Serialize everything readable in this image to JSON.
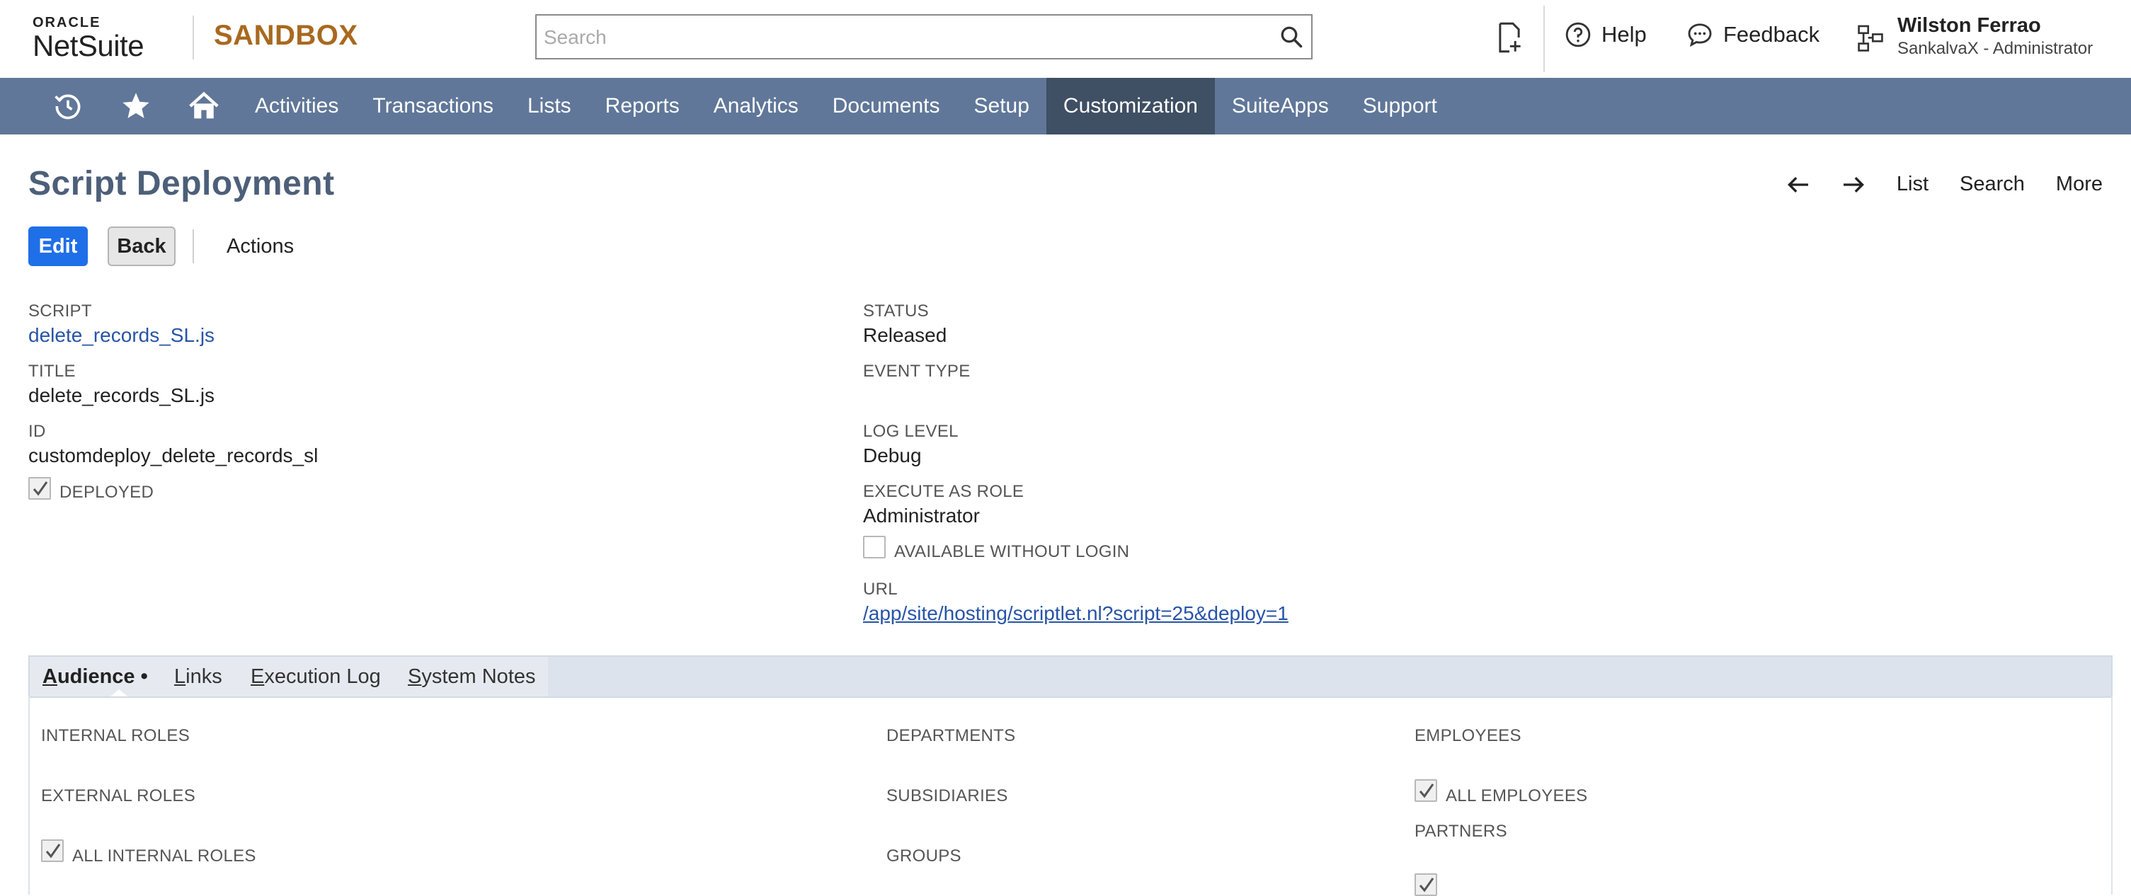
{
  "header": {
    "logo_top": "ORACLE",
    "logo_bottom": "NetSuite",
    "environment": "SANDBOX",
    "search_placeholder": "Search",
    "help": "Help",
    "feedback": "Feedback",
    "user_name": "Wilston Ferrao",
    "user_role": "SankalvaX - Administrator"
  },
  "nav": {
    "items": [
      {
        "label": "Activities"
      },
      {
        "label": "Transactions"
      },
      {
        "label": "Lists"
      },
      {
        "label": "Reports"
      },
      {
        "label": "Analytics"
      },
      {
        "label": "Documents"
      },
      {
        "label": "Setup"
      },
      {
        "label": "Customization"
      },
      {
        "label": "SuiteApps"
      },
      {
        "label": "Support"
      }
    ],
    "active": "Customization"
  },
  "page": {
    "title": "Script Deployment",
    "tools": {
      "list": "List",
      "search": "Search",
      "more": "More"
    },
    "buttons": {
      "edit": "Edit",
      "back": "Back",
      "actions": "Actions"
    }
  },
  "fields": {
    "script_label": "SCRIPT",
    "script_value": "delete_records_SL.js",
    "title_label": "TITLE",
    "title_value": "delete_records_SL.js",
    "id_label": "ID",
    "id_value": "customdeploy_delete_records_sl",
    "deployed_label": "DEPLOYED",
    "deployed_checked": true,
    "status_label": "STATUS",
    "status_value": "Released",
    "event_type_label": "EVENT TYPE",
    "log_level_label": "LOG LEVEL",
    "log_level_value": "Debug",
    "execute_as_role_label": "EXECUTE AS ROLE",
    "execute_as_role_value": "Administrator",
    "available_without_login_label": "AVAILABLE WITHOUT LOGIN",
    "available_without_login_checked": false,
    "url_label": "URL",
    "url_value": "/app/site/hosting/scriptlet.nl?script=25&deploy=1"
  },
  "subtabs": {
    "items": [
      {
        "first": "A",
        "rest": "udience",
        "suffix": " •"
      },
      {
        "first": "L",
        "rest": "inks",
        "suffix": ""
      },
      {
        "first": "E",
        "rest": "xecution Log",
        "suffix": ""
      },
      {
        "first": "S",
        "rest": "ystem Notes",
        "suffix": ""
      }
    ],
    "active": "Audience"
  },
  "audience": {
    "internal_roles": "INTERNAL ROLES",
    "external_roles": "EXTERNAL ROLES",
    "all_internal_roles": "ALL INTERNAL ROLES",
    "departments": "DEPARTMENTS",
    "subsidiaries": "SUBSIDIARIES",
    "groups": "GROUPS",
    "employees": "EMPLOYEES",
    "all_employees": "ALL EMPLOYEES",
    "partners": "PARTNERS"
  }
}
